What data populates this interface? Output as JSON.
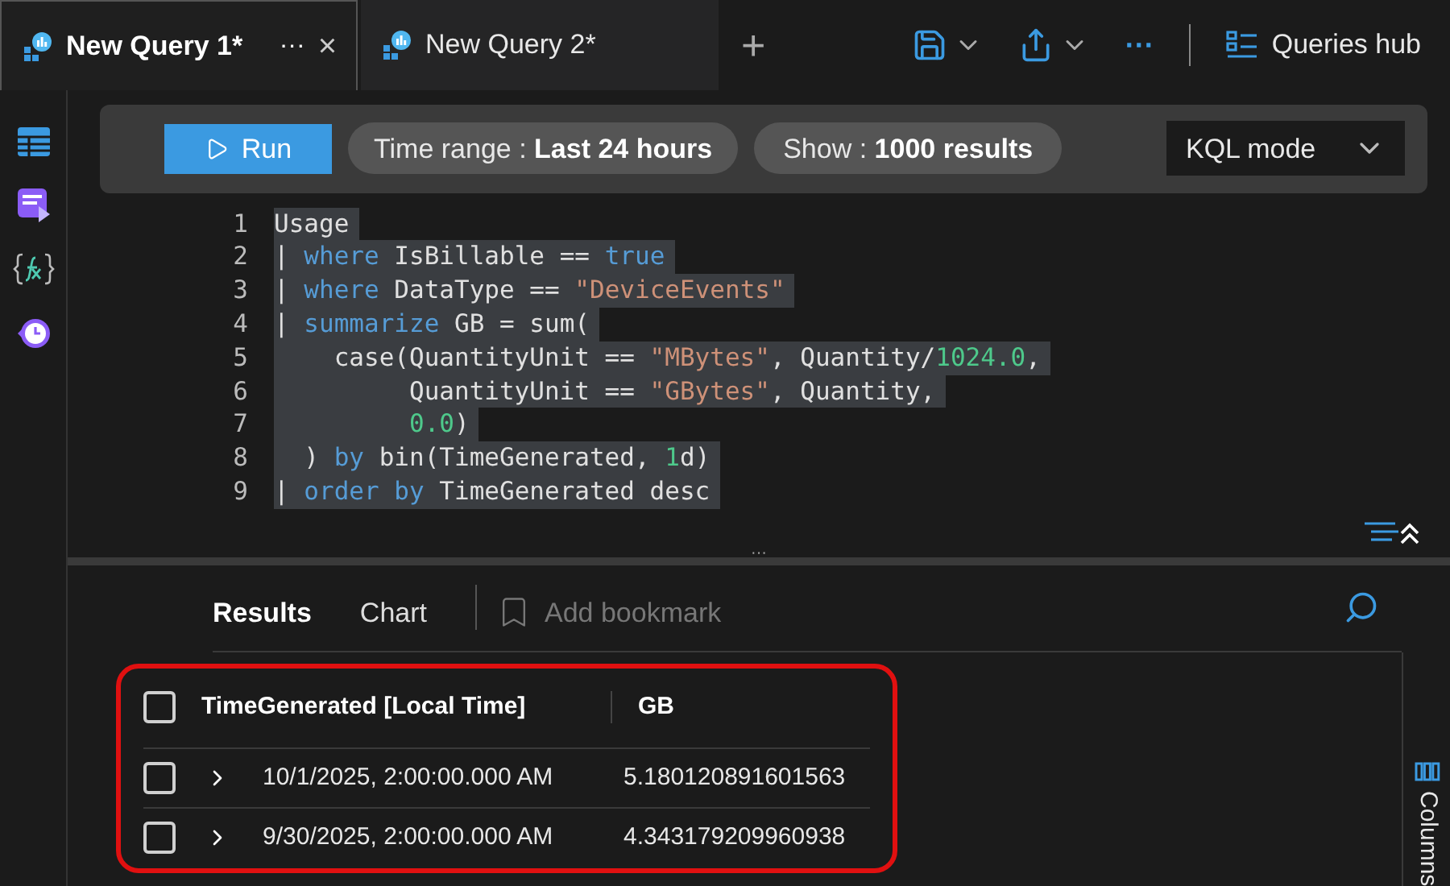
{
  "tabs": [
    {
      "label": "New Query 1*",
      "selected": true,
      "more": "···",
      "close": "×"
    },
    {
      "label": "New Query 2*",
      "selected": false
    }
  ],
  "add_tab": "+",
  "toolbar": {
    "more": "···",
    "queries_hub": "Queries hub"
  },
  "query_bar": {
    "run": "Run",
    "time_range_label": "Time range :",
    "time_range_value": "Last 24 hours",
    "show_label": "Show :",
    "show_value": "1000 results",
    "mode": "KQL mode"
  },
  "editor": {
    "lines": [
      {
        "number": "1",
        "tokens": [
          {
            "kind": "plain",
            "text": "Usage"
          }
        ]
      },
      {
        "number": "2",
        "tokens": [
          {
            "kind": "plain",
            "text": "| "
          },
          {
            "kind": "keyword",
            "text": "where"
          },
          {
            "kind": "plain",
            "text": " IsBillable == "
          },
          {
            "kind": "keyword",
            "text": "true"
          }
        ]
      },
      {
        "number": "3",
        "tokens": [
          {
            "kind": "plain",
            "text": "| "
          },
          {
            "kind": "keyword",
            "text": "where"
          },
          {
            "kind": "plain",
            "text": " DataType == "
          },
          {
            "kind": "string",
            "text": "\"DeviceEvents\""
          }
        ]
      },
      {
        "number": "4",
        "tokens": [
          {
            "kind": "plain",
            "text": "| "
          },
          {
            "kind": "keyword",
            "text": "summarize"
          },
          {
            "kind": "plain",
            "text": " GB = sum("
          }
        ]
      },
      {
        "number": "5",
        "tokens": [
          {
            "kind": "plain",
            "text": "    case(QuantityUnit == "
          },
          {
            "kind": "string",
            "text": "\"MBytes\""
          },
          {
            "kind": "plain",
            "text": ", Quantity/"
          },
          {
            "kind": "number",
            "text": "1024.0"
          },
          {
            "kind": "plain",
            "text": ","
          }
        ]
      },
      {
        "number": "6",
        "tokens": [
          {
            "kind": "plain",
            "text": "         QuantityUnit == "
          },
          {
            "kind": "string",
            "text": "\"GBytes\""
          },
          {
            "kind": "plain",
            "text": ", Quantity,"
          }
        ]
      },
      {
        "number": "7",
        "tokens": [
          {
            "kind": "number",
            "text": "         0.0"
          },
          {
            "kind": "plain",
            "text": ")"
          }
        ]
      },
      {
        "number": "8",
        "tokens": [
          {
            "kind": "plain",
            "text": "  ) "
          },
          {
            "kind": "keyword",
            "text": "by"
          },
          {
            "kind": "plain",
            "text": " bin(TimeGenerated, "
          },
          {
            "kind": "number",
            "text": "1"
          },
          {
            "kind": "plain",
            "text": "d)"
          }
        ]
      },
      {
        "number": "9",
        "tokens": [
          {
            "kind": "plain",
            "text": "| "
          },
          {
            "kind": "keyword",
            "text": "order by"
          },
          {
            "kind": "plain",
            "text": " TimeGenerated desc"
          }
        ]
      }
    ]
  },
  "splitter": "···",
  "results": {
    "tabs": [
      {
        "label": "Results",
        "selected": true
      },
      {
        "label": "Chart",
        "selected": false
      }
    ],
    "add_bookmark": "Add bookmark",
    "columns": [
      "TimeGenerated [Local Time]",
      "GB"
    ],
    "rows": [
      {
        "checked": false,
        "cells": [
          "10/1/2025, 2:00:00.000 AM",
          "5.180120891601563"
        ]
      },
      {
        "checked": false,
        "cells": [
          "9/30/2025, 2:00:00.000 AM",
          "4.343179209960938"
        ]
      }
    ],
    "header_checked": false,
    "columns_panel": "Columns"
  }
}
